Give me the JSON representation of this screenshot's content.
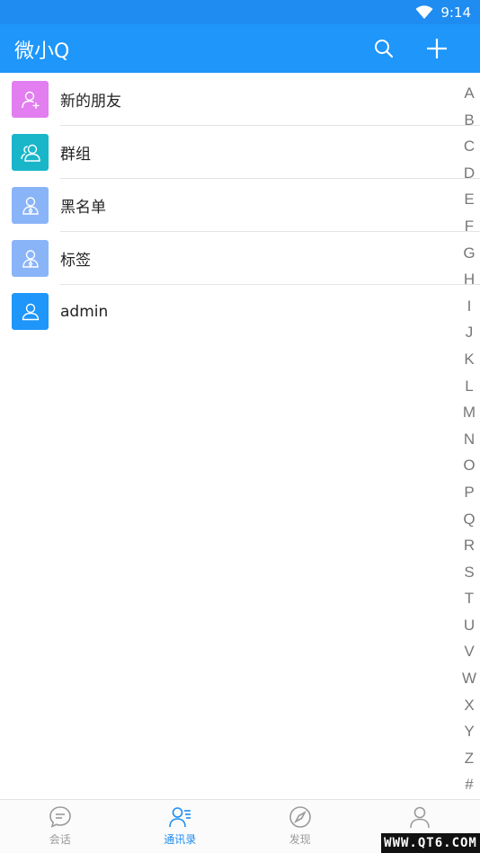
{
  "status_bar": {
    "time": "9:14"
  },
  "app_bar": {
    "title": "微小Q"
  },
  "contacts": [
    {
      "label": "新的朋友",
      "icon": "add-user-icon",
      "color": "#e27ef0"
    },
    {
      "label": "群组",
      "icon": "group-icon",
      "color": "#19b6c9"
    },
    {
      "label": "黑名单",
      "icon": "blacklist-icon",
      "color": "#8ab4f8"
    },
    {
      "label": "标签",
      "icon": "tag-icon",
      "color": "#8ab4f8"
    },
    {
      "label": "admin",
      "icon": "user-icon",
      "color": "#1e96fa"
    }
  ],
  "index_letters": [
    "A",
    "B",
    "C",
    "D",
    "E",
    "F",
    "G",
    "H",
    "I",
    "J",
    "K",
    "L",
    "M",
    "N",
    "O",
    "P",
    "Q",
    "R",
    "S",
    "T",
    "U",
    "V",
    "W",
    "X",
    "Y",
    "Z",
    "#"
  ],
  "bottom_nav": {
    "tabs": [
      {
        "label": "会话",
        "icon": "chat-icon",
        "active": false
      },
      {
        "label": "通讯录",
        "icon": "contacts-icon",
        "active": true
      },
      {
        "label": "发现",
        "icon": "compass-icon",
        "active": false
      },
      {
        "label": "",
        "icon": "profile-icon",
        "active": false
      }
    ]
  },
  "watermark": "WWW.QT6.COM",
  "colors": {
    "primary": "#1e96fa",
    "status_bar": "#1e8cf1",
    "active_tab": "#1e8cf1"
  }
}
